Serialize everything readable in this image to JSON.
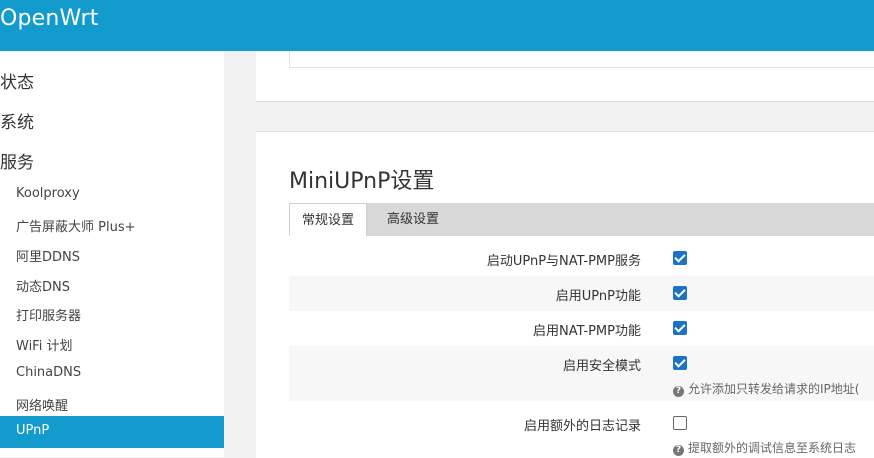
{
  "header": {
    "brand": "OpenWrt"
  },
  "sidebar": {
    "top_items": [
      "状态",
      "系统",
      "服务"
    ],
    "sub_items": [
      "Koolproxy",
      "广告屏蔽大师 Plus+",
      "阿里DDNS",
      "动态DNS",
      "打印服务器",
      "WiFi 计划",
      "ChinaDNS",
      "网络唤醒"
    ],
    "active_item": "UPnP"
  },
  "main": {
    "title": "MiniUPnP设置",
    "tabs": [
      {
        "label": "常规设置",
        "active": true
      },
      {
        "label": "高级设置",
        "active": false
      }
    ],
    "options": [
      {
        "label": "启动UPnP与NAT-PMP服务",
        "checked": true
      },
      {
        "label": "启用UPnP功能",
        "checked": true
      },
      {
        "label": "启用NAT-PMP功能",
        "checked": true
      },
      {
        "label": "启用安全模式",
        "checked": true,
        "hint": "允许添加只转发给请求的IP地址("
      },
      {
        "label": "启用额外的日志记录",
        "checked": false,
        "hint": "提取额外的调试信息至系统日志"
      }
    ]
  },
  "colors": {
    "accent": "#139bce",
    "checkbox": "#1a73c8"
  }
}
